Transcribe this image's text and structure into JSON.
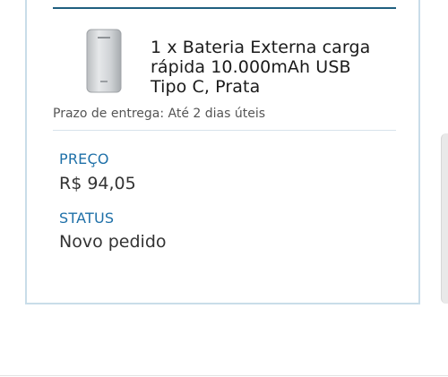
{
  "product": {
    "name": "1 x Bateria Externa carga rápida 10.000mAh USB Tipo C, Prata",
    "image_icon": "power-bank-image"
  },
  "delivery": {
    "text": "Prazo de entrega: Até 2 dias úteis"
  },
  "price": {
    "label": "PREÇO",
    "value": "R$ 94,05"
  },
  "status": {
    "label": "STATUS",
    "value": "Novo pedido"
  },
  "colors": {
    "accent": "#1e70a8",
    "top_rule": "#1f5f7f",
    "card_border": "#c9dde9"
  }
}
